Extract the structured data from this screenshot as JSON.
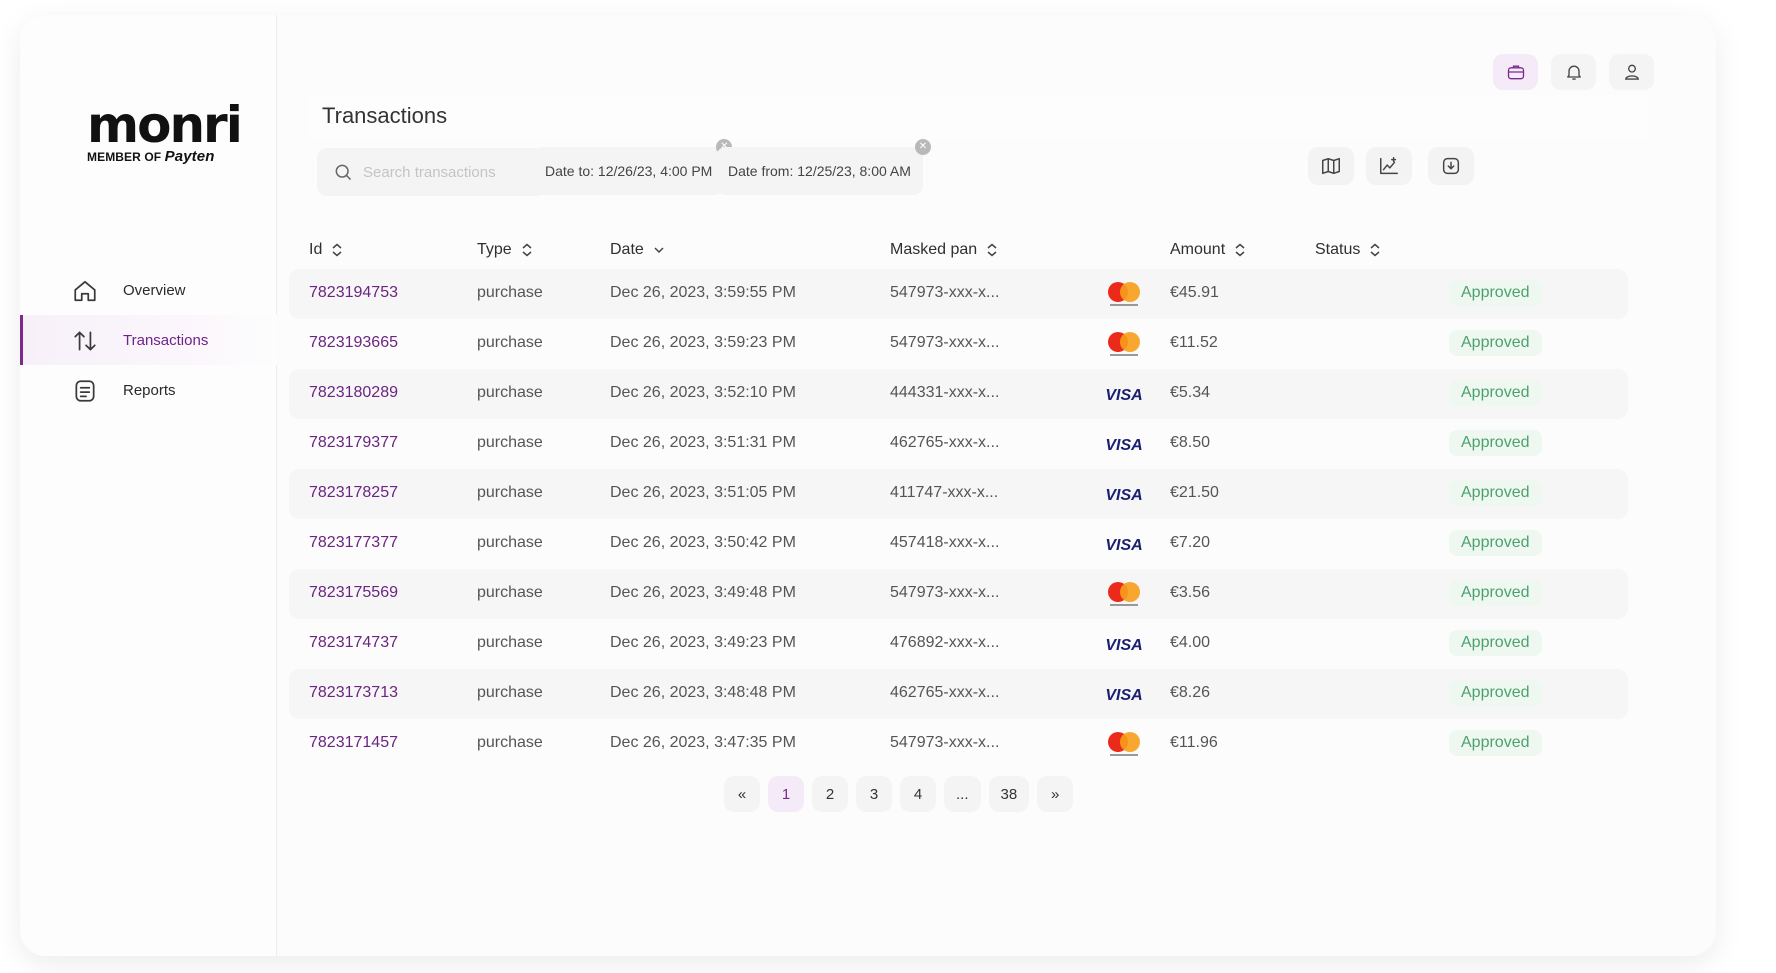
{
  "brand": {
    "logo_word": "monri",
    "logo_member": "MEMBER OF",
    "logo_payten": "Payten"
  },
  "sidebar": {
    "items": [
      {
        "label": "Overview",
        "icon": "home-icon",
        "active": false
      },
      {
        "label": "Transactions",
        "icon": "arrows-up-down-icon",
        "active": true
      },
      {
        "label": "Reports",
        "icon": "report-icon",
        "active": false
      }
    ]
  },
  "header": {
    "title": "Transactions",
    "icons": [
      "briefcase-icon",
      "bell-icon",
      "user-icon"
    ]
  },
  "filters": {
    "search_placeholder": "Search transactions",
    "date_to": "Date to: 12/26/23, 4:00 PM",
    "date_from": "Date from: 12/25/23, 8:00 AM",
    "tools": [
      "map-icon",
      "chart-icon",
      "download-icon"
    ]
  },
  "table": {
    "columns": [
      "Id",
      "Type",
      "Date",
      "Masked pan",
      "Amount",
      "Status"
    ],
    "rows": [
      {
        "id": "7823194753",
        "type": "purchase",
        "date": "Dec 26, 2023, 3:59:55 PM",
        "pan": "547973-xxx-x...",
        "brand": "mastercard",
        "amount": "€45.91",
        "status": "Approved"
      },
      {
        "id": "7823193665",
        "type": "purchase",
        "date": "Dec 26, 2023, 3:59:23 PM",
        "pan": "547973-xxx-x...",
        "brand": "mastercard",
        "amount": "€11.52",
        "status": "Approved"
      },
      {
        "id": "7823180289",
        "type": "purchase",
        "date": "Dec 26, 2023, 3:52:10 PM",
        "pan": "444331-xxx-x...",
        "brand": "visa",
        "amount": "€5.34",
        "status": "Approved"
      },
      {
        "id": "7823179377",
        "type": "purchase",
        "date": "Dec 26, 2023, 3:51:31 PM",
        "pan": "462765-xxx-x...",
        "brand": "visa",
        "amount": "€8.50",
        "status": "Approved"
      },
      {
        "id": "7823178257",
        "type": "purchase",
        "date": "Dec 26, 2023, 3:51:05 PM",
        "pan": "411747-xxx-x...",
        "brand": "visa",
        "amount": "€21.50",
        "status": "Approved"
      },
      {
        "id": "7823177377",
        "type": "purchase",
        "date": "Dec 26, 2023, 3:50:42 PM",
        "pan": "457418-xxx-x...",
        "brand": "visa",
        "amount": "€7.20",
        "status": "Approved"
      },
      {
        "id": "7823175569",
        "type": "purchase",
        "date": "Dec 26, 2023, 3:49:48 PM",
        "pan": "547973-xxx-x...",
        "brand": "mastercard",
        "amount": "€3.56",
        "status": "Approved"
      },
      {
        "id": "7823174737",
        "type": "purchase",
        "date": "Dec 26, 2023, 3:49:23 PM",
        "pan": "476892-xxx-x...",
        "brand": "visa",
        "amount": "€4.00",
        "status": "Approved"
      },
      {
        "id": "7823173713",
        "type": "purchase",
        "date": "Dec 26, 2023, 3:48:48 PM",
        "pan": "462765-xxx-x...",
        "brand": "visa",
        "amount": "€8.26",
        "status": "Approved"
      },
      {
        "id": "7823171457",
        "type": "purchase",
        "date": "Dec 26, 2023, 3:47:35 PM",
        "pan": "547973-xxx-x...",
        "brand": "mastercard",
        "amount": "€11.96",
        "status": "Approved"
      }
    ]
  },
  "pagination": {
    "prev": "«",
    "pages": [
      "1",
      "2",
      "3",
      "4",
      "...",
      "38"
    ],
    "current": "1",
    "next": "»"
  },
  "colors": {
    "accent": "#7b2a8c",
    "link": "#6b2482",
    "approved_text": "#4ca26d",
    "approved_bg": "#eef8f1"
  }
}
